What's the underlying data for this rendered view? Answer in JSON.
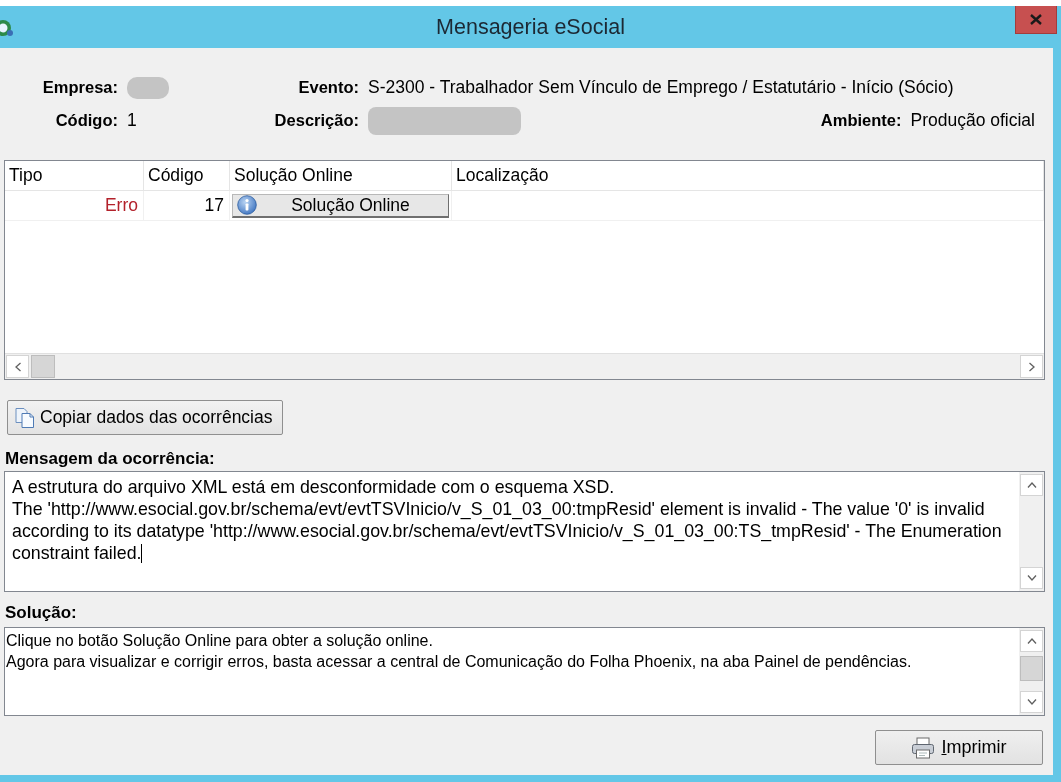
{
  "window": {
    "title": "Mensageria eSocial"
  },
  "details": [
    [
      {
        "kind": "redacted",
        "label": "Empresa:"
      },
      {
        "kind": "text",
        "label": "Evento:",
        "value": "S-2300 - Trabalhador Sem Vínculo de Emprego / Estatutário - Início (Sócio)"
      }
    ],
    [
      {
        "kind": "text",
        "label": "Código:",
        "value": "1"
      },
      {
        "kind": "redacted",
        "label": "Descrição:"
      },
      {
        "kind": "text",
        "label": "Ambiente:",
        "value": "Produção oficial"
      }
    ]
  ],
  "occurrences": {
    "columns": [
      "Tipo",
      "Código",
      "Solução Online",
      "Localização"
    ],
    "rows": [
      {
        "selected": false,
        "cells": [
          {
            "kind": "status",
            "text": "Erro",
            "color": "#b3212b"
          },
          {
            "kind": "number",
            "text": "17"
          },
          {
            "kind": "button",
            "text": "Solução Online"
          }
        ]
      }
    ]
  },
  "copy_button": {
    "label": "Copiar dados das ocorrências"
  },
  "message": {
    "label": "Mensagem da ocorrência:",
    "text": "A estrutura do arquivo XML está em desconformidade com o esquema XSD.\nThe 'http://www.esocial.gov.br/schema/evt/evtTSVInicio/v_S_01_03_00:tmpResid' element is invalid - The value '0' is invalid according to its datatype 'http://www.esocial.gov.br/schema/evt/evtTSVInicio/v_S_01_03_00:TS_tmpResid' - The Enumeration constraint failed.",
    "focused": true
  },
  "solution": {
    "label": "Solução:",
    "text": "Clique no botão Solução Online para obter a solução online.\nAgora para visualizar e corrigir erros, basta acessar a central de Comunicação do Folha Phoenix, na aba Painel de pendências.",
    "focused": false
  },
  "print_button": {
    "label_parts": [
      {
        "text": "I",
        "underlined": true
      },
      {
        "text": "mprimir",
        "underlined": false
      }
    ]
  }
}
